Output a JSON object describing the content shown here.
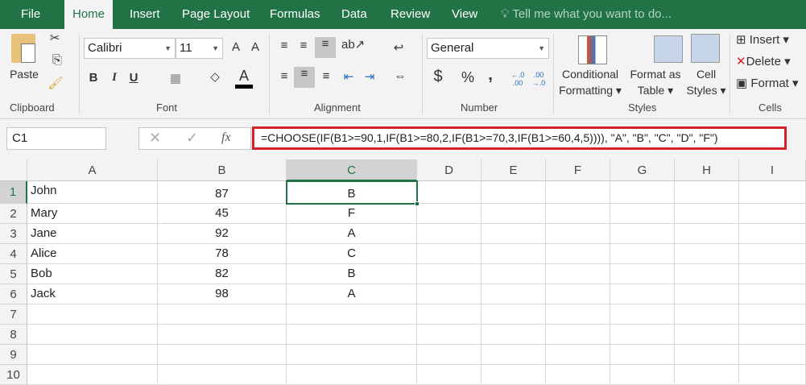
{
  "tabs": [
    "File",
    "Home",
    "Insert",
    "Page Layout",
    "Formulas",
    "Data",
    "Review",
    "View"
  ],
  "active_tab": "Home",
  "tell_me": "Tell me what you want to do...",
  "clipboard": {
    "paste": "Paste",
    "label": "Clipboard"
  },
  "font": {
    "name": "Calibri",
    "size": "11",
    "bold": "B",
    "italic": "I",
    "underline": "U",
    "label": "Font"
  },
  "alignment": {
    "label": "Alignment"
  },
  "number": {
    "format": "General",
    "currency": "$",
    "percent": "%",
    "comma": ",",
    "inc_decimal": "←.0 .00",
    "dec_decimal": ".00 →.0",
    "label": "Number"
  },
  "styles": {
    "conditional": [
      "Conditional",
      "Formatting"
    ],
    "format_table": [
      "Format as",
      "Table"
    ],
    "cell_styles": [
      "Cell",
      "Styles"
    ],
    "label": "Styles"
  },
  "cells": {
    "insert": "Insert",
    "delete": "Delete",
    "format": "Format",
    "label": "Cells"
  },
  "formula_bar": {
    "name_box": "C1",
    "fx": "fx",
    "cancel": "✕",
    "enter": "✓",
    "formula": "=CHOOSE(IF(B1>=90,1,IF(B1>=80,2,IF(B1>=70,3,IF(B1>=60,4,5)))), \"A\", \"B\", \"C\", \"D\", \"F\")"
  },
  "columns": [
    "A",
    "B",
    "C",
    "D",
    "E",
    "F",
    "G",
    "H",
    "I"
  ],
  "rows": [
    "1",
    "2",
    "3",
    "4",
    "5",
    "6",
    "7",
    "8",
    "9",
    "10"
  ],
  "data": [
    {
      "name": "John",
      "score": "87",
      "grade": "B"
    },
    {
      "name": "Mary",
      "score": "45",
      "grade": "F"
    },
    {
      "name": "Jane",
      "score": "92",
      "grade": "A"
    },
    {
      "name": "Alice",
      "score": "78",
      "grade": "C"
    },
    {
      "name": "Bob",
      "score": "82",
      "grade": "B"
    },
    {
      "name": "Jack",
      "score": "98",
      "grade": "A"
    }
  ],
  "selected_cell": "C1"
}
